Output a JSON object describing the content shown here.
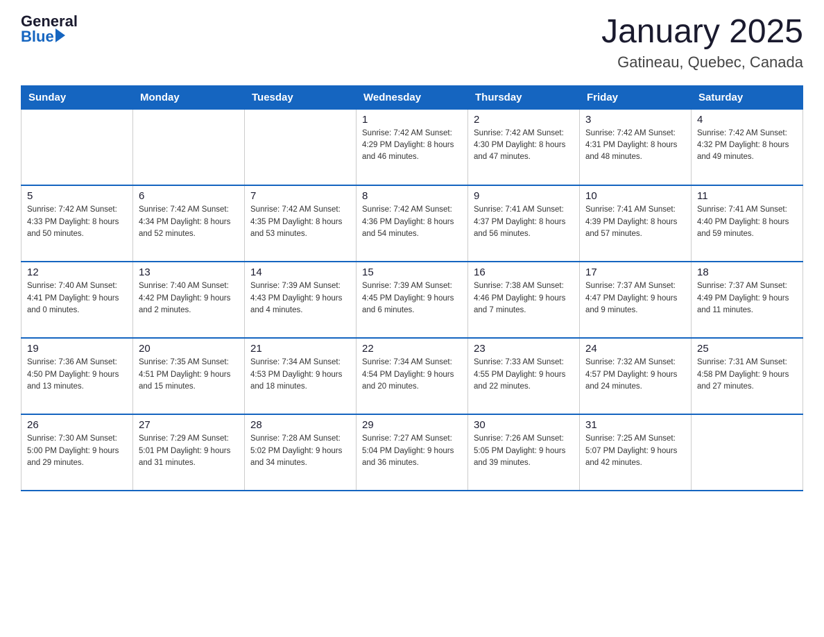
{
  "header": {
    "logo_general": "General",
    "logo_blue": "Blue",
    "title": "January 2025",
    "subtitle": "Gatineau, Quebec, Canada"
  },
  "days_of_week": [
    "Sunday",
    "Monday",
    "Tuesday",
    "Wednesday",
    "Thursday",
    "Friday",
    "Saturday"
  ],
  "weeks": [
    [
      {
        "day": "",
        "info": ""
      },
      {
        "day": "",
        "info": ""
      },
      {
        "day": "",
        "info": ""
      },
      {
        "day": "1",
        "info": "Sunrise: 7:42 AM\nSunset: 4:29 PM\nDaylight: 8 hours\nand 46 minutes."
      },
      {
        "day": "2",
        "info": "Sunrise: 7:42 AM\nSunset: 4:30 PM\nDaylight: 8 hours\nand 47 minutes."
      },
      {
        "day": "3",
        "info": "Sunrise: 7:42 AM\nSunset: 4:31 PM\nDaylight: 8 hours\nand 48 minutes."
      },
      {
        "day": "4",
        "info": "Sunrise: 7:42 AM\nSunset: 4:32 PM\nDaylight: 8 hours\nand 49 minutes."
      }
    ],
    [
      {
        "day": "5",
        "info": "Sunrise: 7:42 AM\nSunset: 4:33 PM\nDaylight: 8 hours\nand 50 minutes."
      },
      {
        "day": "6",
        "info": "Sunrise: 7:42 AM\nSunset: 4:34 PM\nDaylight: 8 hours\nand 52 minutes."
      },
      {
        "day": "7",
        "info": "Sunrise: 7:42 AM\nSunset: 4:35 PM\nDaylight: 8 hours\nand 53 minutes."
      },
      {
        "day": "8",
        "info": "Sunrise: 7:42 AM\nSunset: 4:36 PM\nDaylight: 8 hours\nand 54 minutes."
      },
      {
        "day": "9",
        "info": "Sunrise: 7:41 AM\nSunset: 4:37 PM\nDaylight: 8 hours\nand 56 minutes."
      },
      {
        "day": "10",
        "info": "Sunrise: 7:41 AM\nSunset: 4:39 PM\nDaylight: 8 hours\nand 57 minutes."
      },
      {
        "day": "11",
        "info": "Sunrise: 7:41 AM\nSunset: 4:40 PM\nDaylight: 8 hours\nand 59 minutes."
      }
    ],
    [
      {
        "day": "12",
        "info": "Sunrise: 7:40 AM\nSunset: 4:41 PM\nDaylight: 9 hours\nand 0 minutes."
      },
      {
        "day": "13",
        "info": "Sunrise: 7:40 AM\nSunset: 4:42 PM\nDaylight: 9 hours\nand 2 minutes."
      },
      {
        "day": "14",
        "info": "Sunrise: 7:39 AM\nSunset: 4:43 PM\nDaylight: 9 hours\nand 4 minutes."
      },
      {
        "day": "15",
        "info": "Sunrise: 7:39 AM\nSunset: 4:45 PM\nDaylight: 9 hours\nand 6 minutes."
      },
      {
        "day": "16",
        "info": "Sunrise: 7:38 AM\nSunset: 4:46 PM\nDaylight: 9 hours\nand 7 minutes."
      },
      {
        "day": "17",
        "info": "Sunrise: 7:37 AM\nSunset: 4:47 PM\nDaylight: 9 hours\nand 9 minutes."
      },
      {
        "day": "18",
        "info": "Sunrise: 7:37 AM\nSunset: 4:49 PM\nDaylight: 9 hours\nand 11 minutes."
      }
    ],
    [
      {
        "day": "19",
        "info": "Sunrise: 7:36 AM\nSunset: 4:50 PM\nDaylight: 9 hours\nand 13 minutes."
      },
      {
        "day": "20",
        "info": "Sunrise: 7:35 AM\nSunset: 4:51 PM\nDaylight: 9 hours\nand 15 minutes."
      },
      {
        "day": "21",
        "info": "Sunrise: 7:34 AM\nSunset: 4:53 PM\nDaylight: 9 hours\nand 18 minutes."
      },
      {
        "day": "22",
        "info": "Sunrise: 7:34 AM\nSunset: 4:54 PM\nDaylight: 9 hours\nand 20 minutes."
      },
      {
        "day": "23",
        "info": "Sunrise: 7:33 AM\nSunset: 4:55 PM\nDaylight: 9 hours\nand 22 minutes."
      },
      {
        "day": "24",
        "info": "Sunrise: 7:32 AM\nSunset: 4:57 PM\nDaylight: 9 hours\nand 24 minutes."
      },
      {
        "day": "25",
        "info": "Sunrise: 7:31 AM\nSunset: 4:58 PM\nDaylight: 9 hours\nand 27 minutes."
      }
    ],
    [
      {
        "day": "26",
        "info": "Sunrise: 7:30 AM\nSunset: 5:00 PM\nDaylight: 9 hours\nand 29 minutes."
      },
      {
        "day": "27",
        "info": "Sunrise: 7:29 AM\nSunset: 5:01 PM\nDaylight: 9 hours\nand 31 minutes."
      },
      {
        "day": "28",
        "info": "Sunrise: 7:28 AM\nSunset: 5:02 PM\nDaylight: 9 hours\nand 34 minutes."
      },
      {
        "day": "29",
        "info": "Sunrise: 7:27 AM\nSunset: 5:04 PM\nDaylight: 9 hours\nand 36 minutes."
      },
      {
        "day": "30",
        "info": "Sunrise: 7:26 AM\nSunset: 5:05 PM\nDaylight: 9 hours\nand 39 minutes."
      },
      {
        "day": "31",
        "info": "Sunrise: 7:25 AM\nSunset: 5:07 PM\nDaylight: 9 hours\nand 42 minutes."
      },
      {
        "day": "",
        "info": ""
      }
    ]
  ]
}
